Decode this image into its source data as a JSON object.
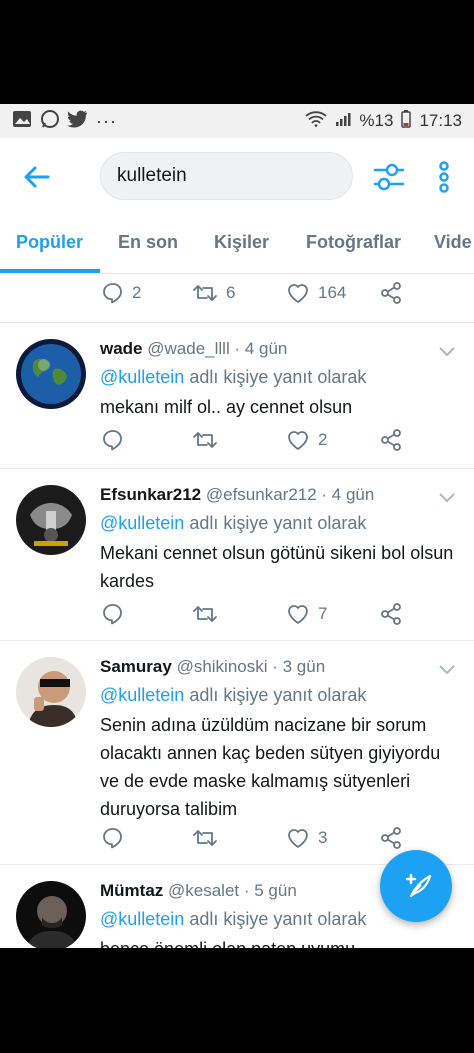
{
  "status_bar": {
    "battery": "%13",
    "time": "17:13"
  },
  "search": {
    "query": "kulletein"
  },
  "tabs": [
    {
      "label": "Popüler"
    },
    {
      "label": "En son"
    },
    {
      "label": "Kişiler"
    },
    {
      "label": "Fotoğraflar"
    },
    {
      "label": "Vide"
    }
  ],
  "partial_tweet": {
    "replies": "2",
    "retweets": "6",
    "likes": "164"
  },
  "tweets": [
    {
      "name": "wade",
      "handle": "@wade_llll · 4 gün",
      "mention": "@kulletein",
      "reply_suffix": " adlı kişiye yanıt olarak",
      "text": "mekanı milf ol.. ay cennet olsun",
      "likes": "2"
    },
    {
      "name": "Efsunkar212",
      "handle": "@efsunkar212 · 4 gün",
      "mention": "@kulletein",
      "reply_suffix": " adlı kişiye yanıt olarak",
      "text": "Mekani cennet olsun götünü sikeni bol olsun kardes",
      "likes": "7"
    },
    {
      "name": "Samuray",
      "handle": "@shikinoski · 3 gün",
      "mention": "@kulletein",
      "reply_suffix": " adlı kişiye yanıt olarak",
      "text": "Senin adına üzüldüm nacizane bir sorum olacaktı annen kaç beden sütyen giyiyordu ve de evde maske kalmamış sütyenleri duruyorsa talibim",
      "likes": "3"
    },
    {
      "name": "Mümtaz",
      "handle": "@kesalet · 5 gün",
      "mention": "@kulletein",
      "reply_suffix": " adlı kişiye yanıt olarak",
      "text": "bence önemli olan paten uyumu"
    }
  ],
  "colors": {
    "accent": "#1da1f2",
    "text_primary": "#14171a",
    "text_secondary": "#657786",
    "divider": "#e6ecf0"
  }
}
